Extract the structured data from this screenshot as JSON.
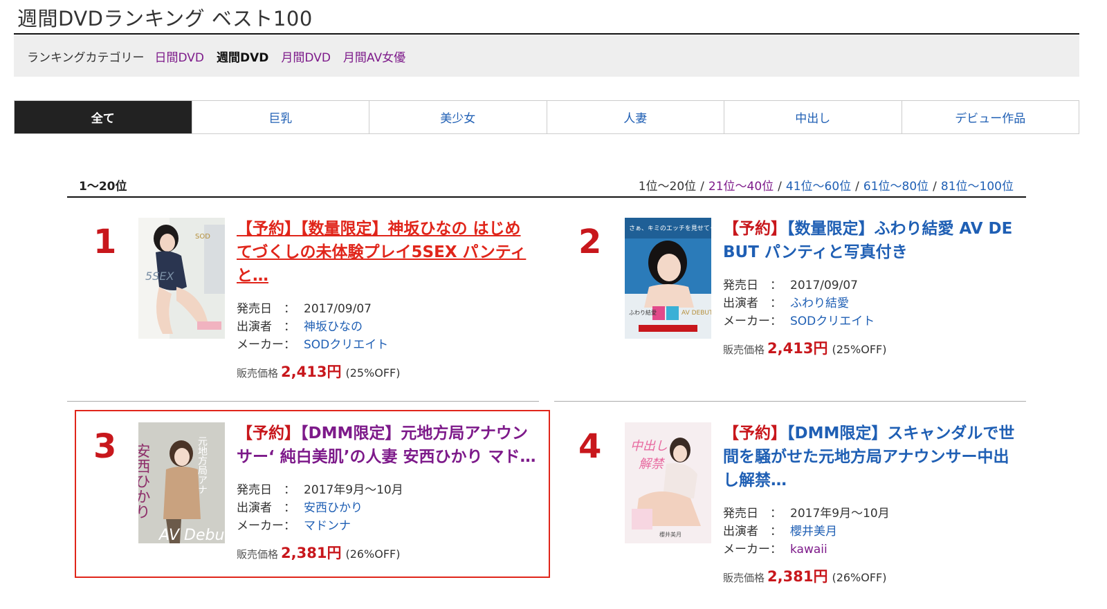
{
  "page_title": "週間DVDランキング ベスト100",
  "category_bar": {
    "label": "ランキングカテゴリー",
    "items": [
      {
        "label": "日間DVD",
        "active": false
      },
      {
        "label": "週間DVD",
        "active": true
      },
      {
        "label": "月間DVD",
        "active": false
      },
      {
        "label": "月間AV女優",
        "active": false
      }
    ]
  },
  "tabs": [
    {
      "label": "全て",
      "active": true
    },
    {
      "label": "巨乳"
    },
    {
      "label": "美少女"
    },
    {
      "label": "人妻"
    },
    {
      "label": "中出し"
    },
    {
      "label": "デビュー作品"
    }
  ],
  "range_label": "1〜20位",
  "pager": {
    "current": "1位〜20位",
    "links": [
      "21位〜40位",
      "41位〜60位",
      "61位〜80位",
      "81位〜100位"
    ],
    "separator": "/"
  },
  "labels": {
    "release": "発売日",
    "performer": "出演者",
    "maker": "メーカー",
    "colon": "：",
    "price": "販売価格"
  },
  "items": [
    {
      "rank": "1",
      "tag1": "【予約】",
      "title": "【数量限定】神坂ひなの はじめてづくしの未体験プレイ5SEX パンティと…",
      "title_lines": [
        "【予約】【数量限定】神坂ひなの はじめ",
        "てづくしの未体験プレイ5SEX パンティ",
        "と…"
      ],
      "release": "2017/09/07",
      "performer": "神坂ひなの",
      "maker": "SODクリエイト",
      "price": "2,413円",
      "discount": "(25%OFF)"
    },
    {
      "rank": "2",
      "title_tag": "【予約】",
      "title_lines": [
        "【数量限定】ふわり結愛 AV DE",
        "BUT パンティと写真付き"
      ],
      "release": "2017/09/07",
      "performer": "ふわり結愛",
      "maker": "SODクリエイト",
      "price": "2,413円",
      "discount": "(25%OFF)"
    },
    {
      "rank": "3",
      "title_tag": "【予約】",
      "title_lines": [
        "【DMM限定】元地方局アナウン",
        "サー‘ 純白美肌’の人妻 安西ひかり マド…"
      ],
      "release": "2017年9月〜10月",
      "performer": "安西ひかり",
      "maker": "マドンナ",
      "price": "2,381円",
      "discount": "(26%OFF)"
    },
    {
      "rank": "4",
      "title_tag": "【予約】",
      "title_lines": [
        "【DMM限定】スキャンダルで世",
        "間を騒がせた元地方局アナウンサー中出",
        "し解禁…"
      ],
      "release": "2017年9月〜10月",
      "performer": "櫻井美月",
      "maker": "kawaii",
      "price": "2,381円",
      "discount": "(26%OFF)"
    }
  ]
}
